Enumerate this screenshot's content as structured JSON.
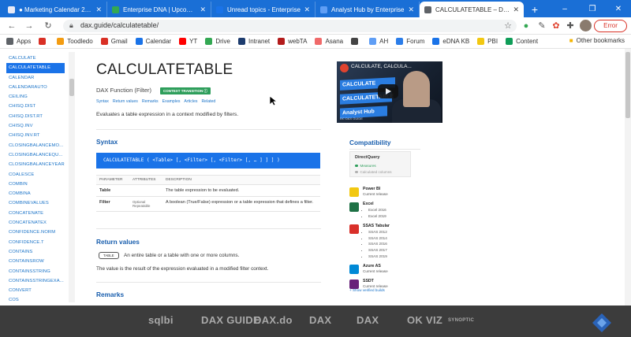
{
  "browser": {
    "tabs": [
      {
        "title": "● Marketing Calendar 2021",
        "favicon": "#e8eaf6",
        "active": false
      },
      {
        "title": "Enterprise DNA | Upcoming",
        "favicon": "#34a853",
        "active": false
      },
      {
        "title": "Unread topics - Enterprise",
        "favicon": "#1a73e8",
        "active": false
      },
      {
        "title": "Analyst Hub by Enterprise",
        "favicon": "#5f9ef5",
        "active": false
      },
      {
        "title": "CALCULATETABLE – DAX G",
        "favicon": "#5f6368",
        "active": true
      }
    ],
    "url": "dax.guide/calculatetable/",
    "error_label": "Error",
    "bookmarks": [
      {
        "label": "Apps",
        "icon": "apps-icon",
        "color": "#5f6368"
      },
      {
        "label": "",
        "icon": "gmail-icon",
        "color": "#d93025"
      },
      {
        "label": "Toodledo",
        "icon": "toodledo-icon",
        "color": "#f39c12"
      },
      {
        "label": "Gmail",
        "icon": "gmail-icon",
        "color": "#d93025"
      },
      {
        "label": "Calendar",
        "icon": "calendar-icon",
        "color": "#1a73e8"
      },
      {
        "label": "YT",
        "icon": "youtube-icon",
        "color": "#ff0000"
      },
      {
        "label": "Drive",
        "icon": "drive-icon",
        "color": "#34a853"
      },
      {
        "label": "Intranet",
        "icon": "intranet-icon",
        "color": "#1d3c6e"
      },
      {
        "label": "webTA",
        "icon": "webta-icon",
        "color": "#b31b1b"
      },
      {
        "label": "Asana",
        "icon": "asana-icon",
        "color": "#f06a6a"
      },
      {
        "label": "",
        "icon": "globe-icon",
        "color": "#444444"
      },
      {
        "label": "AH",
        "icon": "ah-icon",
        "color": "#5f9ef5"
      },
      {
        "label": "Forum",
        "icon": "forum-icon",
        "color": "#2b7de9"
      },
      {
        "label": "eDNA KB",
        "icon": "kb-icon",
        "color": "#1a73e8"
      },
      {
        "label": "PBI",
        "icon": "powerbi-icon",
        "color": "#f2c811"
      },
      {
        "label": "Content",
        "icon": "content-icon",
        "color": "#0f9d58"
      }
    ],
    "other_bookmarks": "Other bookmarks"
  },
  "sidebar": {
    "items": [
      {
        "label": "CALCULATE",
        "active": false
      },
      {
        "label": "CALCULATETABLE",
        "active": true
      },
      {
        "label": "CALENDAR",
        "active": false
      },
      {
        "label": "CALENDARAUTO",
        "active": false
      },
      {
        "label": "CEILING",
        "active": false
      },
      {
        "label": "CHISQ.DIST",
        "active": false
      },
      {
        "label": "CHISQ.DIST.RT",
        "active": false
      },
      {
        "label": "CHISQ.INV",
        "active": false
      },
      {
        "label": "CHISQ.INV.RT",
        "active": false
      },
      {
        "label": "CLOSINGBALANCEMO...",
        "active": false
      },
      {
        "label": "CLOSINGBALANCEQU...",
        "active": false
      },
      {
        "label": "CLOSINGBALANCEYEAR",
        "active": false
      },
      {
        "label": "COALESCE",
        "active": false
      },
      {
        "label": "COMBIN",
        "active": false
      },
      {
        "label": "COMBINA",
        "active": false
      },
      {
        "label": "COMBINEVALUES",
        "active": false
      },
      {
        "label": "CONCATENATE",
        "active": false
      },
      {
        "label": "CONCATENATEX",
        "active": false
      },
      {
        "label": "CONFIDENCE.NORM",
        "active": false
      },
      {
        "label": "CONFIDENCE.T",
        "active": false
      },
      {
        "label": "CONTAINS",
        "active": false
      },
      {
        "label": "CONTAINSROW",
        "active": false
      },
      {
        "label": "CONTAINSSTRING",
        "active": false
      },
      {
        "label": "CONTAINSSTRINGEXA...",
        "active": false
      },
      {
        "label": "CONVERT",
        "active": false
      },
      {
        "label": "COS",
        "active": false
      }
    ]
  },
  "main": {
    "title": "CALCULATETABLE",
    "function_type": "DAX Function (Filter)",
    "badge": "CONTEXT TRANSITION ⓘ",
    "links": [
      "Syntax",
      "Return values",
      "Remarks",
      "Examples",
      "Articles",
      "Related"
    ],
    "description": "Evaluates a table expression in a context modified by filters.",
    "syntax_heading": "Syntax",
    "syntax": "CALCULATETABLE ( <Table> [, <Filter> [, <Filter> [, … ] ] ] )",
    "table_headers": [
      "PARAMETER",
      "ATTRIBUTES",
      "DESCRIPTION"
    ],
    "params": [
      {
        "name": "Table",
        "attributes": "",
        "description": "The table expression to be evaluated."
      },
      {
        "name": "Filter",
        "attributes": "Optional\nRepeatable",
        "description": "A boolean (True/False) expression or a table expression that defines a filter."
      }
    ],
    "return_heading": "Return values",
    "return_badge": "TABLE",
    "return_desc": "An entire table or a table with one or more columns.",
    "return_value": "The value is the result of the expression evaluated in a modified filter context.",
    "remarks_heading": "Remarks"
  },
  "video": {
    "title": "CALCULATE, CALCULA...",
    "band1": "CALCULATE",
    "band2": "CALCULATETABLE",
    "band3": "Analyst Hub",
    "footer": "DC DAX GUIDE"
  },
  "compat": {
    "heading": "Compatibility",
    "directquery": {
      "name": "DirectQuery",
      "measures": "Measures",
      "calc_columns": "Calculated columns",
      "measures_color": "#2e9e5b",
      "calc_color": "#b0b0b0"
    },
    "products": [
      {
        "name": "Power BI",
        "sub": "Current release",
        "versions": [],
        "color": "#f2c811",
        "icon": "powerbi-icon"
      },
      {
        "name": "Excel",
        "sub": "",
        "versions": [
          "Excel 2016",
          "Excel 2019"
        ],
        "color": "#1e7145",
        "icon": "excel-icon"
      },
      {
        "name": "SSAS Tabular",
        "sub": "",
        "versions": [
          "SSAS 2012",
          "SSAS 2014",
          "SSAS 2016",
          "SSAS 2017",
          "SSAS 2019"
        ],
        "color": "#d9302a",
        "icon": "ssas-icon"
      },
      {
        "name": "Azure AS",
        "sub": "Current release",
        "versions": [],
        "color": "#0089d6",
        "icon": "azure-icon"
      },
      {
        "name": "SSDT",
        "sub": "Current release",
        "versions": [],
        "color": "#68217a",
        "icon": "ssdt-icon"
      }
    ],
    "show_builds": "+ Show verified builds"
  },
  "footer": {
    "logos": [
      "sqlbi",
      "DAX GUIDE",
      "DAX.do",
      "DAX",
      "DAX",
      "OK VIZ",
      "SYNOPTIC"
    ]
  }
}
